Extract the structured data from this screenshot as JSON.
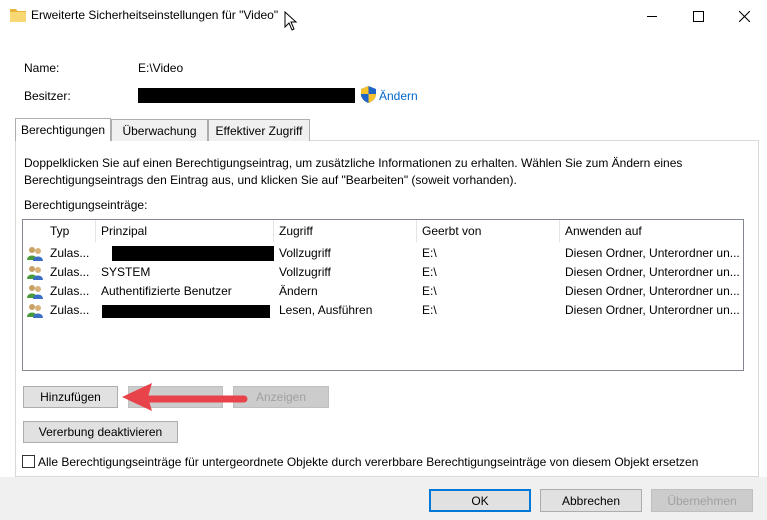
{
  "window": {
    "title": "Erweiterte Sicherheitseinstellungen für \"Video\""
  },
  "info": {
    "name_label": "Name:",
    "name_value": "E:\\Video",
    "owner_label": "Besitzer:",
    "change_link": "Ändern"
  },
  "tabs": [
    "Berechtigungen",
    "Überwachung",
    "Effektiver Zugriff"
  ],
  "instructions": "Doppelklicken Sie auf einen Berechtigungseintrag, um zusätzliche Informationen zu erhalten. Wählen Sie zum Ändern eines Berechtigungseintrags den Eintrag aus, und klicken Sie auf \"Bearbeiten\" (soweit vorhanden).",
  "list_label": "Berechtigungseinträge:",
  "columns": [
    "Typ",
    "Prinzipal",
    "Zugriff",
    "Geerbt von",
    "Anwenden auf"
  ],
  "rows": [
    {
      "type": "Zulas...",
      "principal": "",
      "access": "Vollzugriff",
      "inherited": "E:\\",
      "applies": "Diesen Ordner, Unterordner un..."
    },
    {
      "type": "Zulas...",
      "principal": "SYSTEM",
      "access": "Vollzugriff",
      "inherited": "E:\\",
      "applies": "Diesen Ordner, Unterordner un..."
    },
    {
      "type": "Zulas...",
      "principal": "Authentifizierte Benutzer",
      "access": "Ändern",
      "inherited": "E:\\",
      "applies": "Diesen Ordner, Unterordner un..."
    },
    {
      "type": "Zulas...",
      "principal": "",
      "access": "Lesen, Ausführen",
      "inherited": "E:\\",
      "applies": "Diesen Ordner, Unterordner un..."
    }
  ],
  "buttons": {
    "add": "Hinzufügen",
    "remove": "",
    "view": "Anzeigen",
    "disable_inheritance": "Vererbung deaktivieren",
    "ok": "OK",
    "cancel": "Abbrechen",
    "apply": "Übernehmen"
  },
  "checkbox": {
    "label": "Alle Berechtigungseinträge für untergeordnete Objekte durch vererbbare Berechtigungseinträge von diesem Objekt ersetzen",
    "checked": false
  },
  "colors": {
    "accent": "#0078d7",
    "arrow": "#e8434a",
    "link": "#0066cc"
  },
  "icons": [
    "folder-icon",
    "minimize-icon",
    "maximize-icon",
    "close-icon",
    "uac-shield-icon",
    "users-icon",
    "annotation-arrow"
  ]
}
